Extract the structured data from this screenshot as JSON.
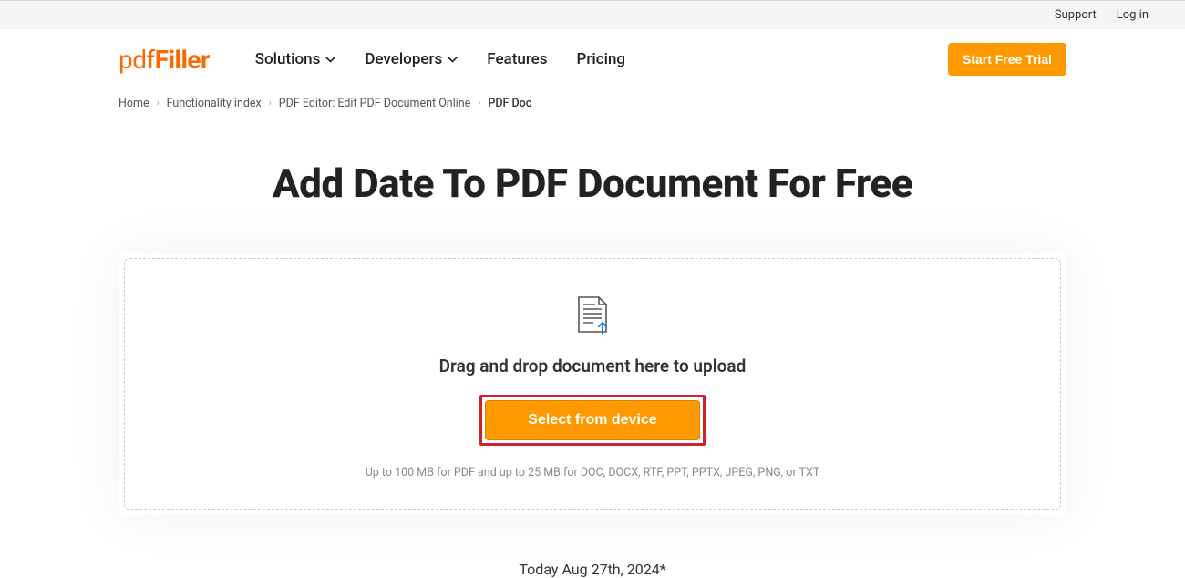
{
  "topbar": {
    "support": "Support",
    "login": "Log in"
  },
  "logo": {
    "part1": "pdf",
    "part2": "Filler"
  },
  "nav": {
    "solutions": "Solutions",
    "developers": "Developers",
    "features": "Features",
    "pricing": "Pricing"
  },
  "cta": {
    "start_trial": "Start Free Trial"
  },
  "breadcrumb": {
    "items": [
      "Home",
      "Functionality index",
      "PDF Editor: Edit PDF Document Online",
      "PDF Doc"
    ]
  },
  "page": {
    "title": "Add Date To PDF Document For Free"
  },
  "upload": {
    "drag_text": "Drag and drop document here to upload",
    "select_button": "Select from device",
    "note": "Up to 100 MB for PDF and up to 25 MB for DOC, DOCX, RTF, PPT, PPTX, JPEG, PNG, or TXT"
  },
  "footer": {
    "today": "Today Aug 27th, 2024*"
  }
}
